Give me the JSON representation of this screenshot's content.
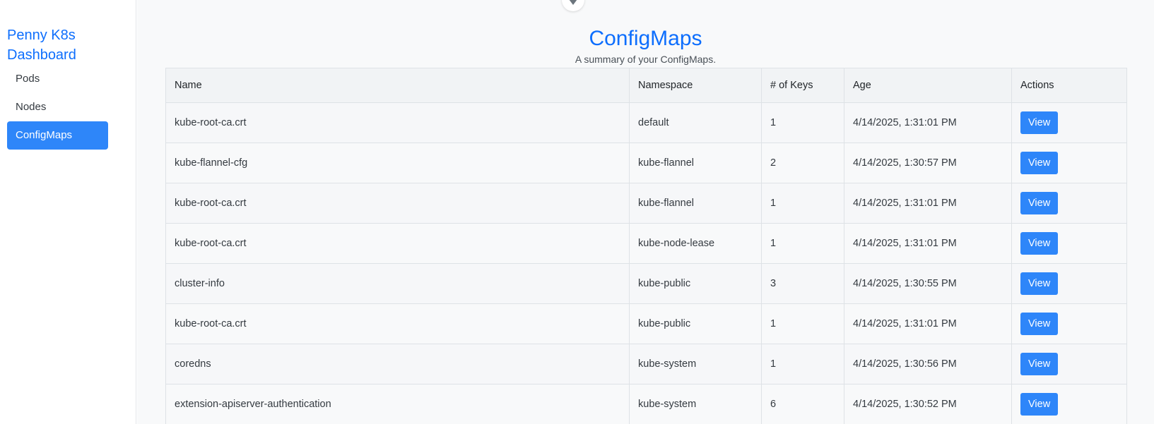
{
  "sidebar": {
    "brand": "Penny K8s Dashboard",
    "items": [
      {
        "label": "Pods",
        "active": false
      },
      {
        "label": "Nodes",
        "active": false
      },
      {
        "label": "ConfigMaps",
        "active": true
      }
    ]
  },
  "main": {
    "collapse_icon": "chevron-down-icon",
    "title": "ConfigMaps",
    "subtitle": "A summary of your ConfigMaps.",
    "table": {
      "columns": [
        "Name",
        "Namespace",
        "# of Keys",
        "Age",
        "Actions"
      ],
      "rows": [
        {
          "name": "kube-root-ca.crt",
          "namespace": "default",
          "keys": "1",
          "age": "4/14/2025, 1:31:01 PM",
          "action": "View"
        },
        {
          "name": "kube-flannel-cfg",
          "namespace": "kube-flannel",
          "keys": "2",
          "age": "4/14/2025, 1:30:57 PM",
          "action": "View"
        },
        {
          "name": "kube-root-ca.crt",
          "namespace": "kube-flannel",
          "keys": "1",
          "age": "4/14/2025, 1:31:01 PM",
          "action": "View"
        },
        {
          "name": "kube-root-ca.crt",
          "namespace": "kube-node-lease",
          "keys": "1",
          "age": "4/14/2025, 1:31:01 PM",
          "action": "View"
        },
        {
          "name": "cluster-info",
          "namespace": "kube-public",
          "keys": "3",
          "age": "4/14/2025, 1:30:55 PM",
          "action": "View"
        },
        {
          "name": "kube-root-ca.crt",
          "namespace": "kube-public",
          "keys": "1",
          "age": "4/14/2025, 1:31:01 PM",
          "action": "View"
        },
        {
          "name": "coredns",
          "namespace": "kube-system",
          "keys": "1",
          "age": "4/14/2025, 1:30:56 PM",
          "action": "View"
        },
        {
          "name": "extension-apiserver-authentication",
          "namespace": "kube-system",
          "keys": "6",
          "age": "4/14/2025, 1:30:52 PM",
          "action": "View"
        }
      ]
    }
  },
  "colors": {
    "accent": "#0d6efd",
    "button": "#2e86f9",
    "main_bg": "#f8f9fa"
  }
}
